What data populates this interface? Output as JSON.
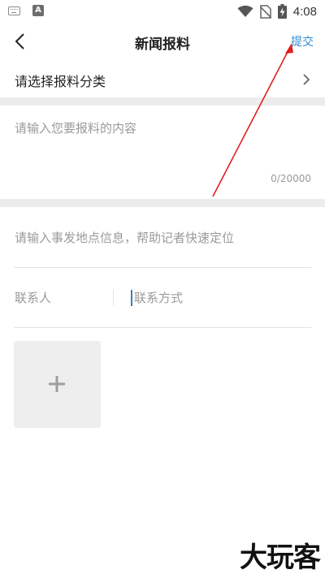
{
  "status_bar": {
    "time": "4:08",
    "left_icons": [
      "keyboard-icon",
      "app-a-icon"
    ],
    "app_icon_letter": "A",
    "right_icons": [
      "wifi-icon",
      "no-sim-icon",
      "battery-charging-icon"
    ]
  },
  "header": {
    "title": "新闻报料",
    "back_icon": "chevron-left-icon",
    "submit_label": "提交",
    "submit_color": "#2f8fd6"
  },
  "category": {
    "label": "请选择报料分类",
    "icon": "chevron-right-icon"
  },
  "content": {
    "placeholder": "请输入您要报料的内容",
    "value": "",
    "counter": "0/20000"
  },
  "location": {
    "placeholder": "请输入事发地点信息，帮助记者快速定位",
    "value": ""
  },
  "contact": {
    "name_placeholder": "联系人",
    "method_placeholder": "联系方式"
  },
  "attachments": {
    "add_icon": "plus-icon"
  },
  "annotation": {
    "arrow_color": "#e02020"
  },
  "watermark": {
    "text": "大玩客"
  }
}
